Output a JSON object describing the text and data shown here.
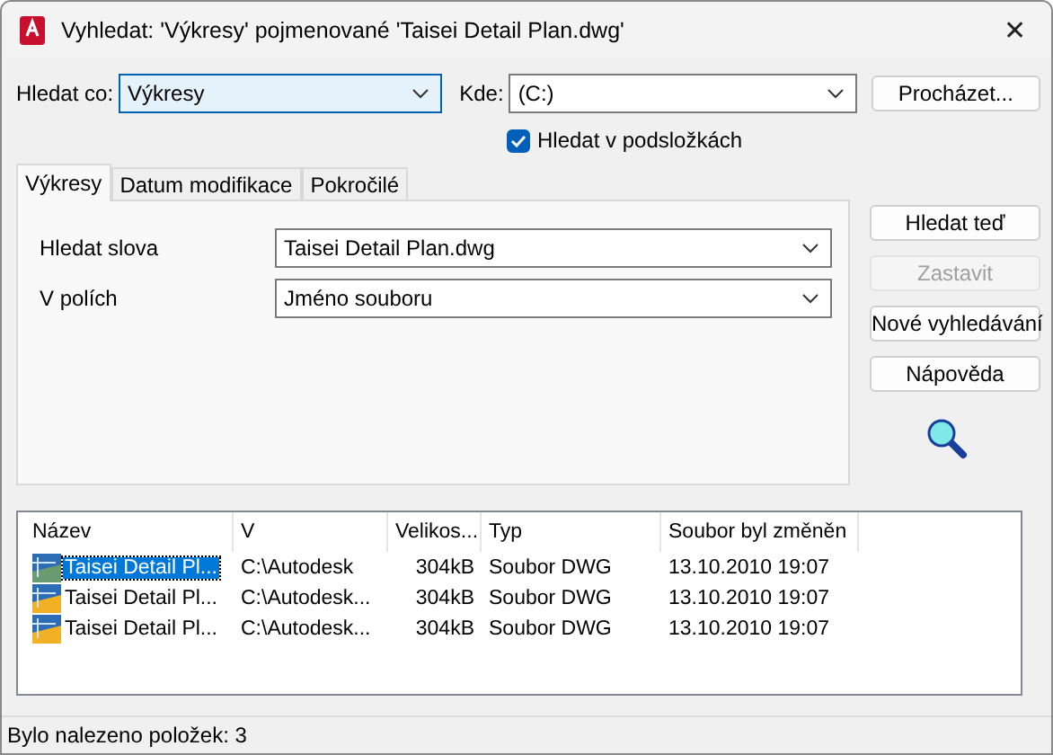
{
  "window": {
    "title": "Vyhledat: 'Výkresy' pojmenované 'Taisei Detail Plan.dwg'",
    "close": "✕"
  },
  "search_for": {
    "label": "Hledat co:",
    "value": "Výkresy"
  },
  "look_in": {
    "label": "Kde:",
    "value": "(C:)"
  },
  "browse_button": "Procházet...",
  "include_subfolders": {
    "label": "Hledat v podsložkách",
    "checked": true
  },
  "tabs": [
    {
      "label": "Výkresy",
      "selected": true
    },
    {
      "label": "Datum modifikace",
      "selected": false
    },
    {
      "label": "Pokročilé",
      "selected": false
    }
  ],
  "fields": [
    {
      "label": "Hledat slova",
      "value": "Taisei Detail Plan.dwg"
    },
    {
      "label": "V polích",
      "value": "Jméno souboru"
    }
  ],
  "buttons": [
    {
      "label": "Hledat teď",
      "disabled": false
    },
    {
      "label": "Zastavit",
      "disabled": true
    },
    {
      "label": "Nové vyhledávání",
      "disabled": false
    },
    {
      "label": "Nápověda",
      "disabled": false
    }
  ],
  "results": {
    "columns": [
      "Název",
      "V",
      "Velikos...",
      "Typ",
      "Soubor byl změněn"
    ],
    "rows": [
      {
        "selected": true,
        "cells": [
          "Taisei Detail Pl...",
          "C:\\Autodesk",
          "304kB",
          "Soubor DWG",
          "13.10.2010 19:07"
        ]
      },
      {
        "selected": false,
        "cells": [
          "Taisei Detail Pl...",
          "C:\\Autodesk...",
          "304kB",
          "Soubor DWG",
          "13.10.2010 19:07"
        ]
      },
      {
        "selected": false,
        "cells": [
          "Taisei Detail Pl...",
          "C:\\Autodesk...",
          "304kB",
          "Soubor DWG",
          "13.10.2010 19:07"
        ]
      }
    ]
  },
  "status_bar": "Bylo nalezeno položek: 3"
}
